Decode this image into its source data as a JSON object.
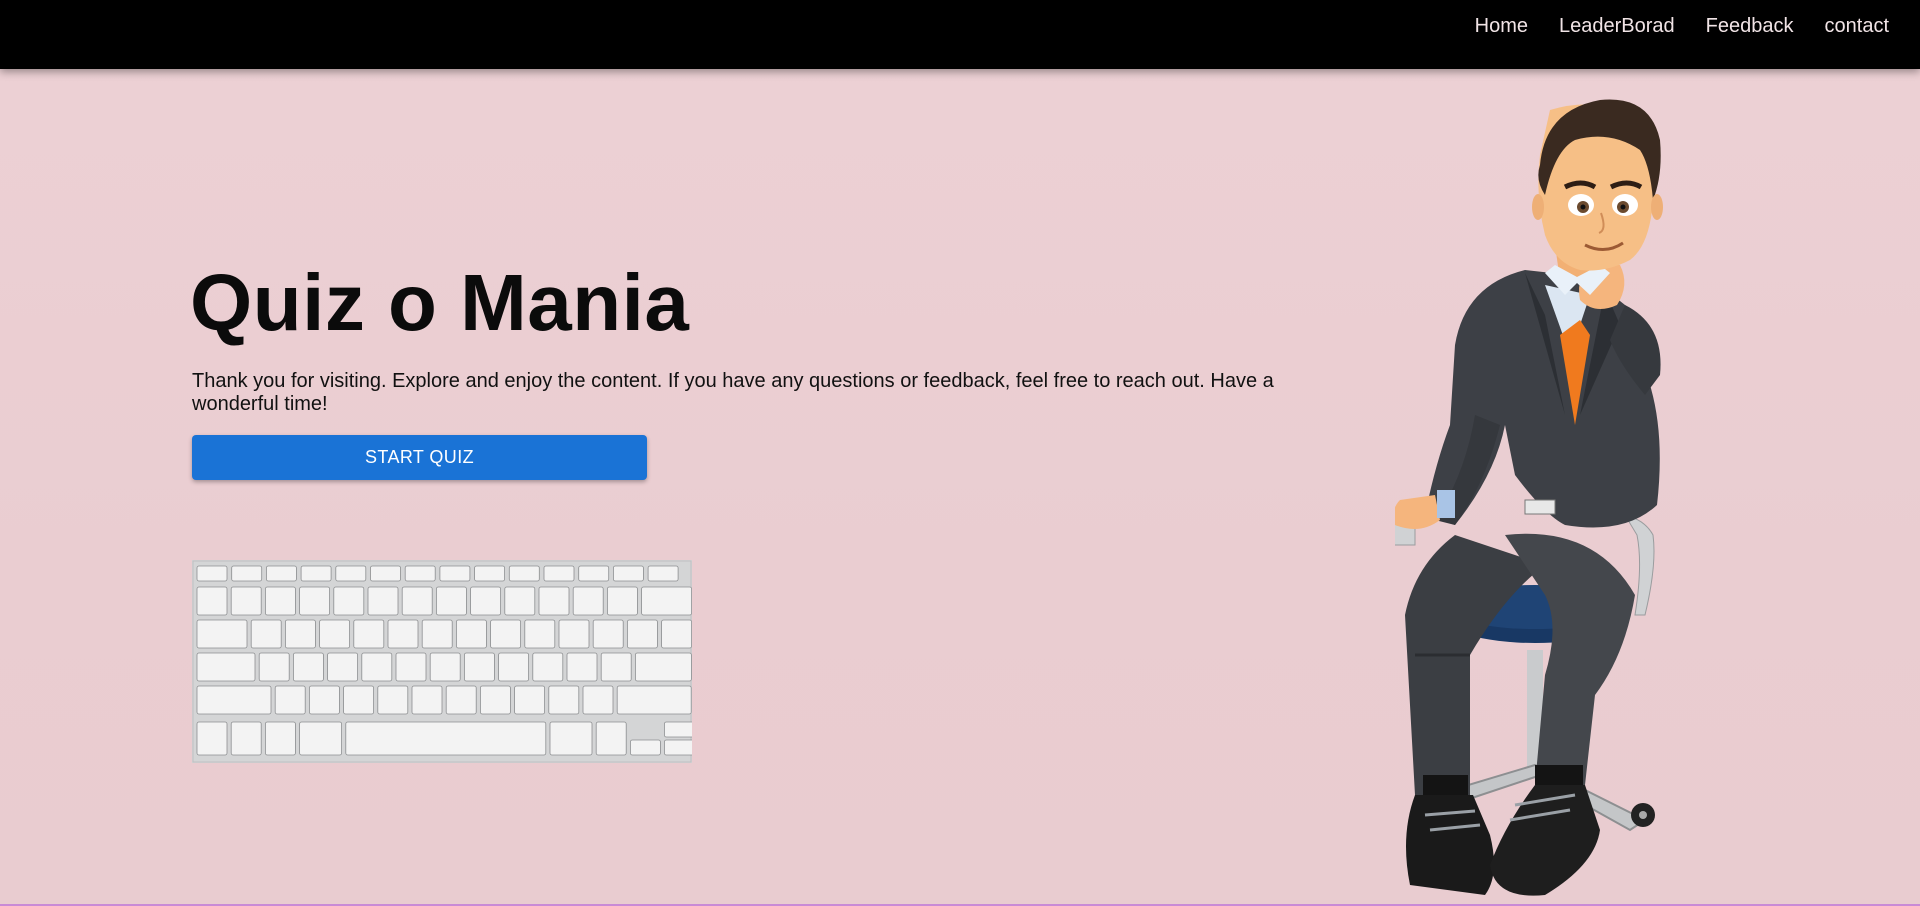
{
  "nav": {
    "links": [
      "Home",
      "LeaderBorad",
      "Feedback",
      "contact"
    ]
  },
  "hero": {
    "title": "Quiz o Mania",
    "intro": "Thank you for visiting. Explore and enjoy the content. If you have any questions or feedback, feel free to reach out. Have a wonderful time!",
    "start_button": "START QUIZ"
  },
  "images": {
    "keyboard": "keyboard-image",
    "character": "businessman-character-image"
  },
  "colors": {
    "navbar": "#000000",
    "background": "#ebcdd2",
    "button": "#1a73d6",
    "bottom_line": "#c98ad6"
  }
}
